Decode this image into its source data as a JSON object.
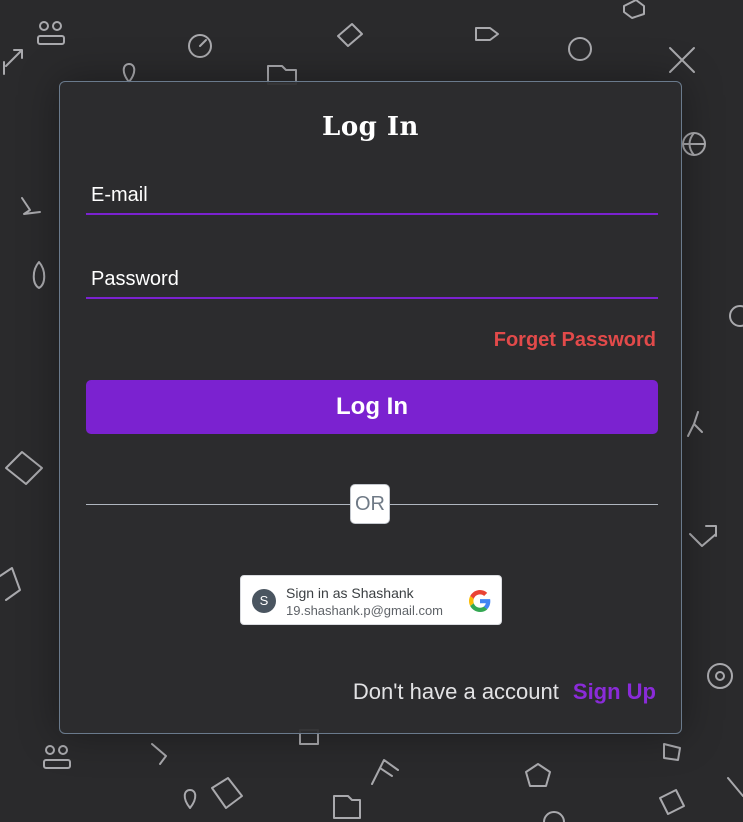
{
  "colors": {
    "background": "#2a2a2c",
    "card_border": "#6a7a8c",
    "accent": "#7b22d0",
    "forget_password": "#e24a4a",
    "signup_link": "#8a2bd8"
  },
  "login": {
    "title": "Log In",
    "email_placeholder": "E-mail",
    "email_value": "",
    "password_placeholder": "Password",
    "password_value": "",
    "forget_password_label": "Forget Password",
    "login_button_label": "Log In",
    "or_label": "OR"
  },
  "google_signin": {
    "avatar_initial": "S",
    "name_label": "Sign in as Shashank",
    "email": "19.shashank.p@gmail.com",
    "logo_icon": "google-g-icon"
  },
  "signup": {
    "prompt": "Don't have a account",
    "link_label": "Sign Up"
  }
}
